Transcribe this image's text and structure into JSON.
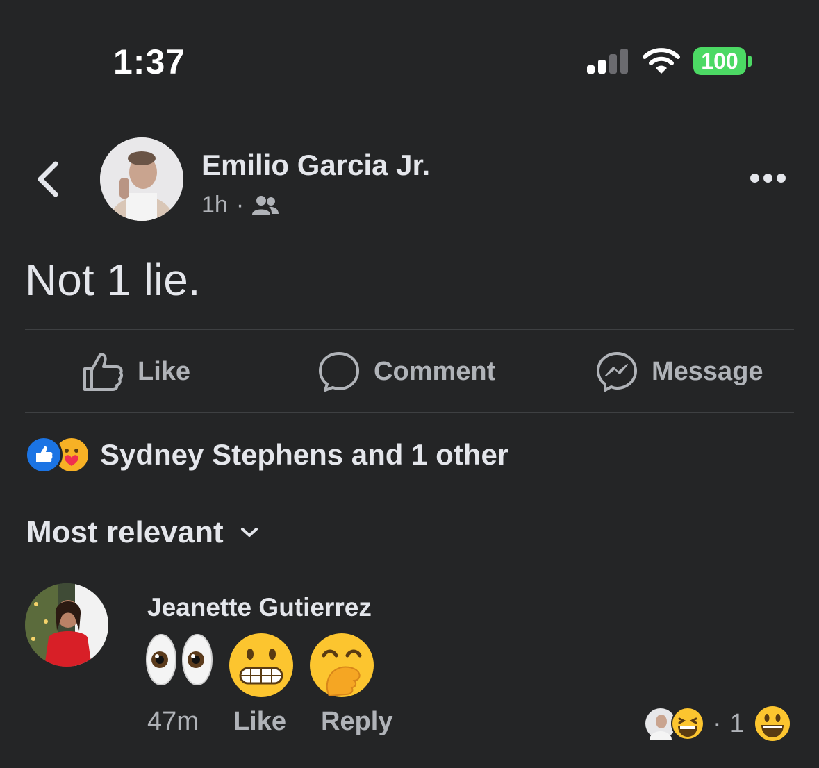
{
  "status_bar": {
    "time": "1:37",
    "battery": "100",
    "battery_color": "#4cd964",
    "icons": [
      "cellular-signal-icon",
      "wifi-icon",
      "battery-icon"
    ]
  },
  "post": {
    "author": "Emilio Garcia Jr.",
    "time": "1h",
    "separator": "·",
    "audience_icon": "friends-icon",
    "text": "Not 1 lie.",
    "actions": [
      {
        "label": "Like",
        "icon": "thumbs-up-icon"
      },
      {
        "label": "Comment",
        "icon": "comment-icon"
      },
      {
        "label": "Message",
        "icon": "messenger-icon"
      }
    ],
    "reactions": {
      "icons": [
        "like-reaction-icon",
        "care-reaction-icon"
      ],
      "summary": "Sydney Stephens and 1 other"
    }
  },
  "comments_section": {
    "sort_label": "Most relevant"
  },
  "comment": {
    "author": "Jeanette Gutierrez",
    "emojis": [
      "eyes-emoji",
      "grimacing-face-emoji",
      "face-with-hand-over-mouth-emoji"
    ],
    "time": "47m",
    "like_label": "Like",
    "reply_label": "Reply",
    "reaction_separator": "·",
    "reaction_count": "1"
  },
  "colors": {
    "background": "#242526",
    "primary_text": "#e4e6eb",
    "secondary_text": "#b0b3b8",
    "divider": "#3e4042",
    "like_blue": "#1b74e4"
  }
}
